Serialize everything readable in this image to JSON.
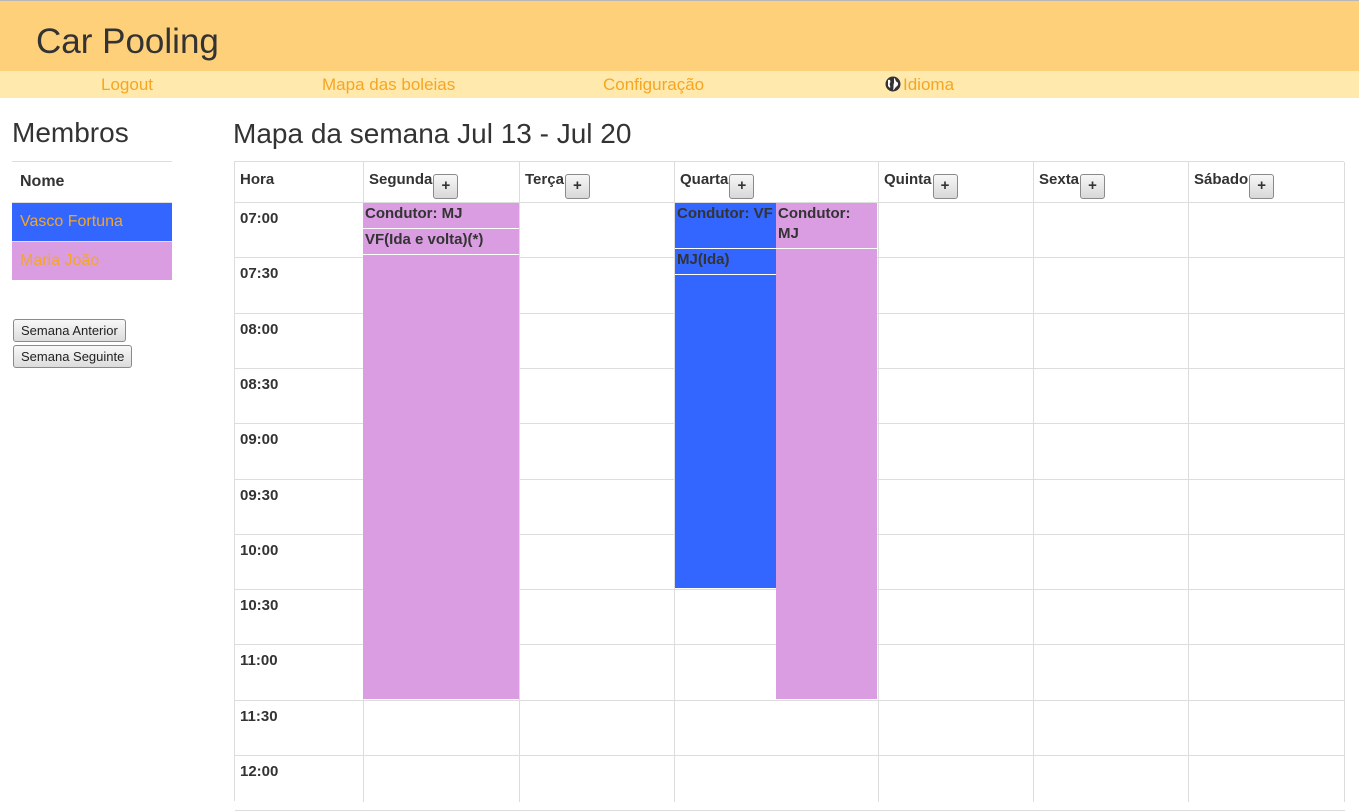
{
  "app": {
    "title": "Car Pooling"
  },
  "nav": [
    {
      "label": "Logout"
    },
    {
      "label": "Mapa das boleias"
    },
    {
      "label": "Configuração"
    },
    {
      "label": "Idioma",
      "icon": "globe-icon"
    }
  ],
  "members": {
    "title": "Membros",
    "header": "Nome",
    "items": [
      {
        "name": "Vasco Fortuna",
        "color": "#3366ff"
      },
      {
        "name": "Maria João",
        "color": "#da9de2"
      }
    ]
  },
  "buttons": {
    "prev_week": "Semana Anterior",
    "next_week": "Semana Seguinte"
  },
  "calendar": {
    "title": "Mapa da semana Jul 13 - Jul 20",
    "hour_header": "Hora",
    "add_label": "+",
    "days": [
      "Segunda",
      "Terça",
      "Quarta",
      "Quinta",
      "Sexta",
      "Sábado"
    ],
    "times": [
      "07:00",
      "07:30",
      "08:00",
      "08:30",
      "09:00",
      "09:30",
      "10:00",
      "10:30",
      "11:00",
      "11:30",
      "12:00"
    ]
  },
  "rides": [
    {
      "day": "Segunda",
      "start": "07:00",
      "end": "11:30",
      "color": "#da9de2",
      "driver_label": "Condutor: MJ",
      "passengers": [
        "VF(Ida e volta)(*)"
      ]
    },
    {
      "day": "Quarta",
      "start": "07:00",
      "end": "10:30",
      "color": "#3366ff",
      "driver_label": "Condutor: VF",
      "passengers": [
        "MJ(Ida)"
      ]
    },
    {
      "day": "Quarta",
      "start": "07:00",
      "end": "11:30",
      "color": "#da9de2",
      "driver_label": "Condutor: MJ",
      "passengers": []
    }
  ]
}
